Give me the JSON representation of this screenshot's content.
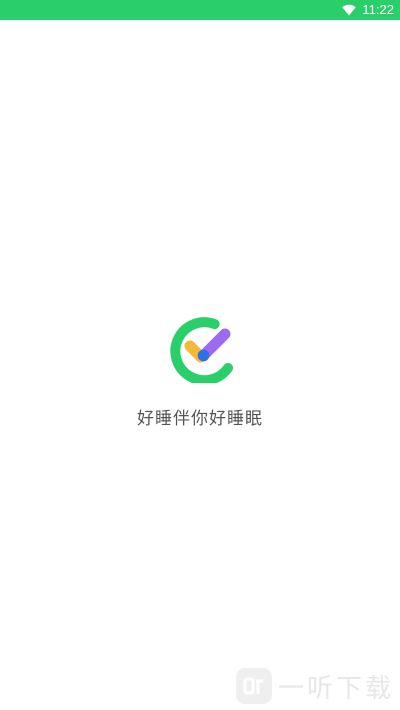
{
  "status_bar": {
    "time": "11:22",
    "wifi_icon": "wifi-icon",
    "color": "#2bcf6a"
  },
  "splash": {
    "logo_icon": "sleep-check-logo-icon",
    "slogan": "好睡伴你好睡眠",
    "colors": {
      "ring": "#2bcf6a",
      "left_stroke": "#f5b939",
      "right_stroke": "#9b6bf2",
      "dot": "#2f6fe8"
    }
  },
  "watermark": {
    "text": "一听下载"
  }
}
